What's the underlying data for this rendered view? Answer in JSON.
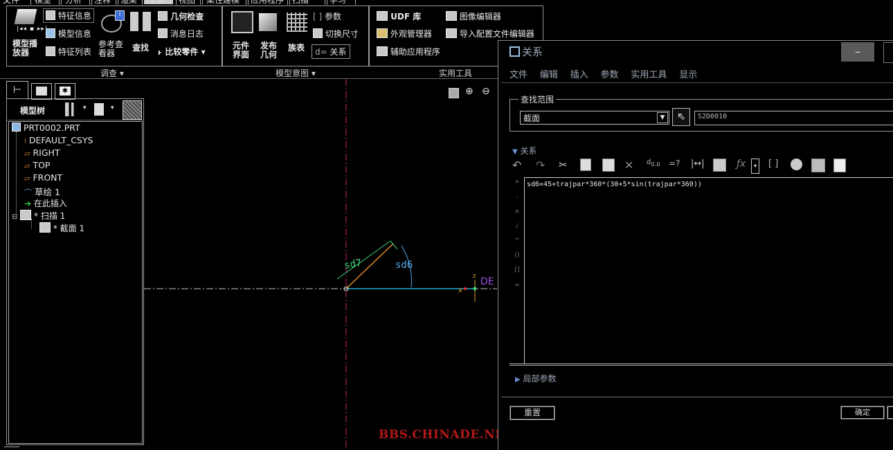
{
  "top_menu": [
    "文件",
    "模型",
    "分析",
    "注释",
    "渲染",
    "工具",
    "视图",
    "柔性建模",
    "应用程序",
    "扫描",
    "学习"
  ],
  "ribbon": {
    "investigate": {
      "group_label": "调查 ▾",
      "model_player_label": "模型播放器",
      "feature_info": "特征信息",
      "model_info": "模型信息",
      "feature_list": "特征列表",
      "reference_viewer": "参考查看器",
      "find": "查找",
      "geometry_check": "几何检查",
      "message_log": "消息日志",
      "compare_parts": "比较零件 ▾"
    },
    "model_intent": {
      "group_label": "模型意图 ▾",
      "component_interface": "元件界面",
      "publish_geometry": "发布几何",
      "family_table": "族表",
      "parameters": "参数",
      "switch_dimensions": "切换尺寸",
      "relations": "关系"
    },
    "utilities": {
      "group_label": "实用工具",
      "udf_library": "UDF 库",
      "appearance_manager": "外观管理器",
      "auxiliary_apps": "辅助应用程序",
      "image_editor": "图像编辑器",
      "import_config_editor": "导入配置文件编辑器"
    }
  },
  "model_tree": {
    "title": "模型树",
    "items": [
      {
        "label": "PRT0002.PRT"
      },
      {
        "label": "DEFAULT_CSYS"
      },
      {
        "label": "RIGHT"
      },
      {
        "label": "TOP"
      },
      {
        "label": "FRONT"
      },
      {
        "label": "草绘 1"
      },
      {
        "label": "在此插入"
      },
      {
        "label": "* 扫描 1"
      },
      {
        "label": "* 截面 1"
      }
    ]
  },
  "canvas": {
    "dim_sd7": "sd7",
    "dim_sd6": "sd6",
    "csys_label": "DE",
    "z_label": "z",
    "x_label": "x",
    "watermark": "BBS.CHINADE.NET"
  },
  "dialog": {
    "title": "关系",
    "menu": [
      "文件",
      "编辑",
      "插入",
      "参数",
      "实用工具",
      "显示"
    ],
    "lookup_scope_label": "查找范围",
    "scope_select": "截面",
    "scope_value": "S2D0010",
    "relations_section": "关系",
    "relation_text": "sd6=45+trajpar*360*(30+5*sin(trajpar*360))",
    "side_ops": [
      "+",
      "-",
      "×",
      "/",
      "^",
      "()",
      "[]",
      "="
    ],
    "local_params": "局部参数",
    "reset_button": "重置",
    "ok_button": "确定",
    "minimize": "–"
  }
}
